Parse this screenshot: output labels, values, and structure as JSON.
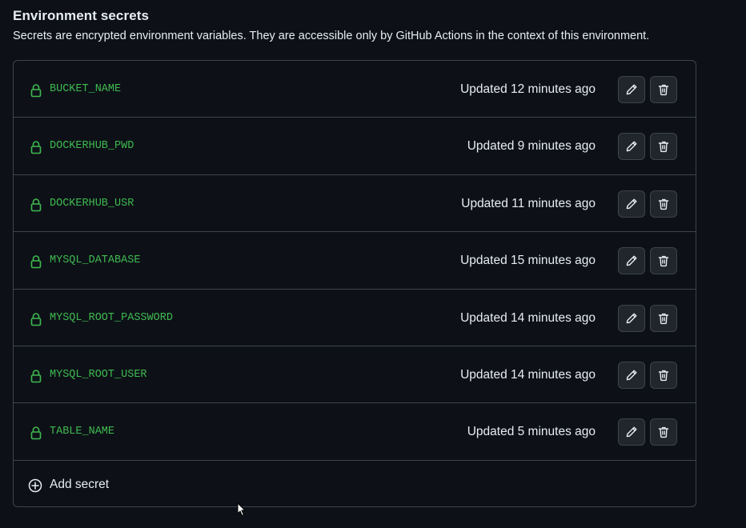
{
  "section": {
    "title": "Environment secrets",
    "description": "Secrets are encrypted environment variables. They are accessible only by GitHub Actions in the context of this environment."
  },
  "secrets": [
    {
      "name": "BUCKET_NAME",
      "updated": "Updated 12 minutes ago"
    },
    {
      "name": "DOCKERHUB_PWD",
      "updated": "Updated 9 minutes ago"
    },
    {
      "name": "DOCKERHUB_USR",
      "updated": "Updated 11 minutes ago"
    },
    {
      "name": "MYSQL_DATABASE",
      "updated": "Updated 15 minutes ago"
    },
    {
      "name": "MYSQL_ROOT_PASSWORD",
      "updated": "Updated 14 minutes ago"
    },
    {
      "name": "MYSQL_ROOT_USER",
      "updated": "Updated 14 minutes ago"
    },
    {
      "name": "TABLE_NAME",
      "updated": "Updated 5 minutes ago"
    }
  ],
  "add_secret_label": "Add secret",
  "icons": {
    "secret_icon": "lock-icon",
    "edit_icon": "pencil-icon",
    "delete_icon": "trash-icon",
    "add_icon": "plus-circle-icon"
  },
  "colors": {
    "background": "#0d1117",
    "border": "#3d444d",
    "secret_name": "#3fb950",
    "text": "#e6edf3",
    "button_bg": "#21262d"
  }
}
